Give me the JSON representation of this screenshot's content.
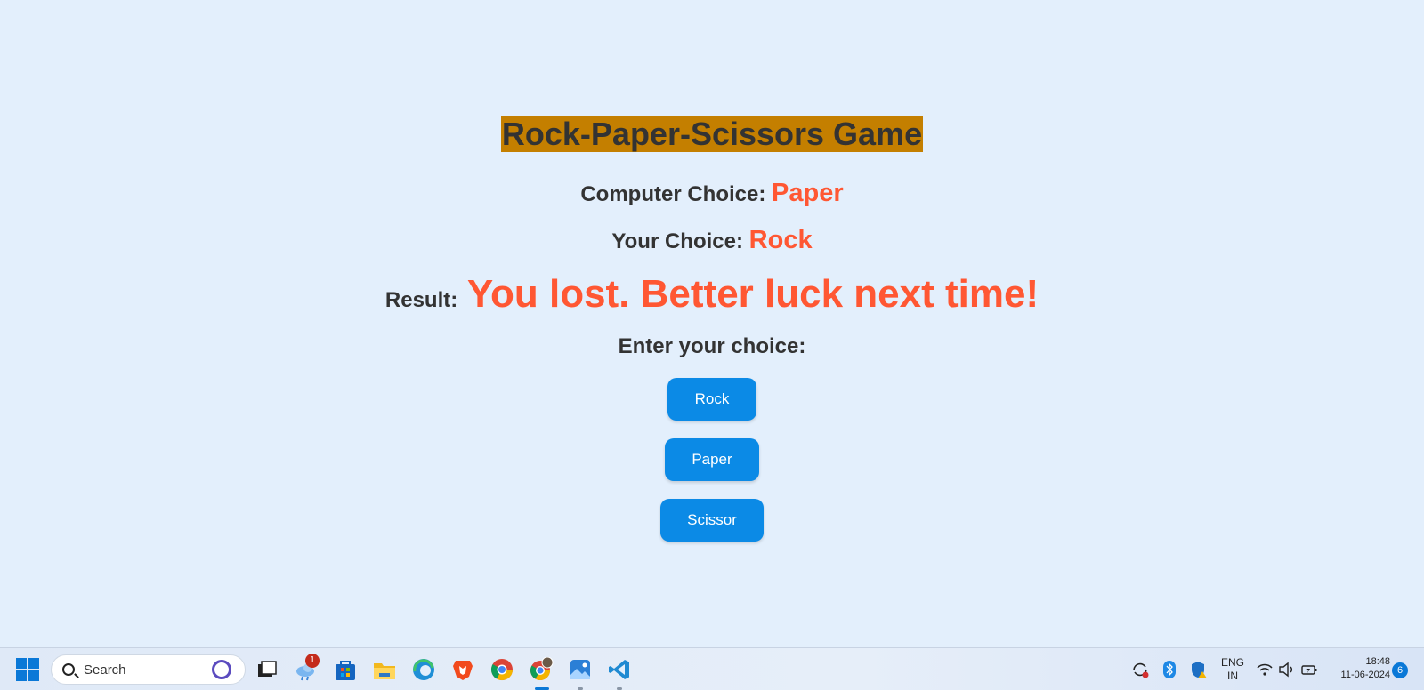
{
  "game": {
    "title": "Rock-Paper-Scissors Game",
    "computer_label": "Computer Choice:",
    "computer_value": "Paper",
    "your_label": "Your Choice:",
    "your_value": "Rock",
    "result_label": "Result:",
    "result_value": "You lost. Better luck next time!",
    "prompt": "Enter your choice:",
    "buttons": [
      "Rock",
      "Paper",
      "Scissor"
    ]
  },
  "taskbar": {
    "search_placeholder": "Search",
    "weather_badge": "1",
    "language": "ENG",
    "region": "IN",
    "time": "18:48",
    "date": "11-06-2024",
    "notifications": "6"
  },
  "colors": {
    "title_bg": "#c47f00",
    "value_text": "#ff5733",
    "button_bg": "#0b8ae6",
    "page_bg": "#e3effc"
  }
}
